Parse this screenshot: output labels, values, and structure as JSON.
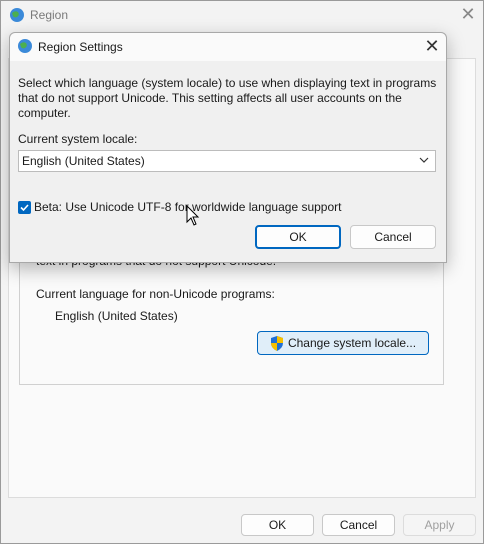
{
  "region_window": {
    "title": "Region",
    "partial_text": "text in programs that do not support Unicode.",
    "current_language_label": "Current language for non-Unicode programs:",
    "current_language_value": "English (United States)",
    "change_locale_label": "Change system locale...",
    "ok_label": "OK",
    "cancel_label": "Cancel",
    "apply_label": "Apply"
  },
  "dialog": {
    "title": "Region Settings",
    "description": "Select which language (system locale) to use when displaying text in programs that do not support Unicode. This setting affects all user accounts on the computer.",
    "locale_label": "Current system locale:",
    "locale_value": "English (United States)",
    "beta_label": "Beta: Use Unicode UTF-8 for worldwide language support",
    "beta_checked": true,
    "ok_label": "OK",
    "cancel_label": "Cancel"
  },
  "colors": {
    "accent": "#0067c0",
    "shield_blue": "#1f6fd6",
    "shield_yellow": "#f6c000"
  },
  "icons": {
    "region_icon": "globe-clock-icon",
    "shield": "uac-shield-icon"
  }
}
